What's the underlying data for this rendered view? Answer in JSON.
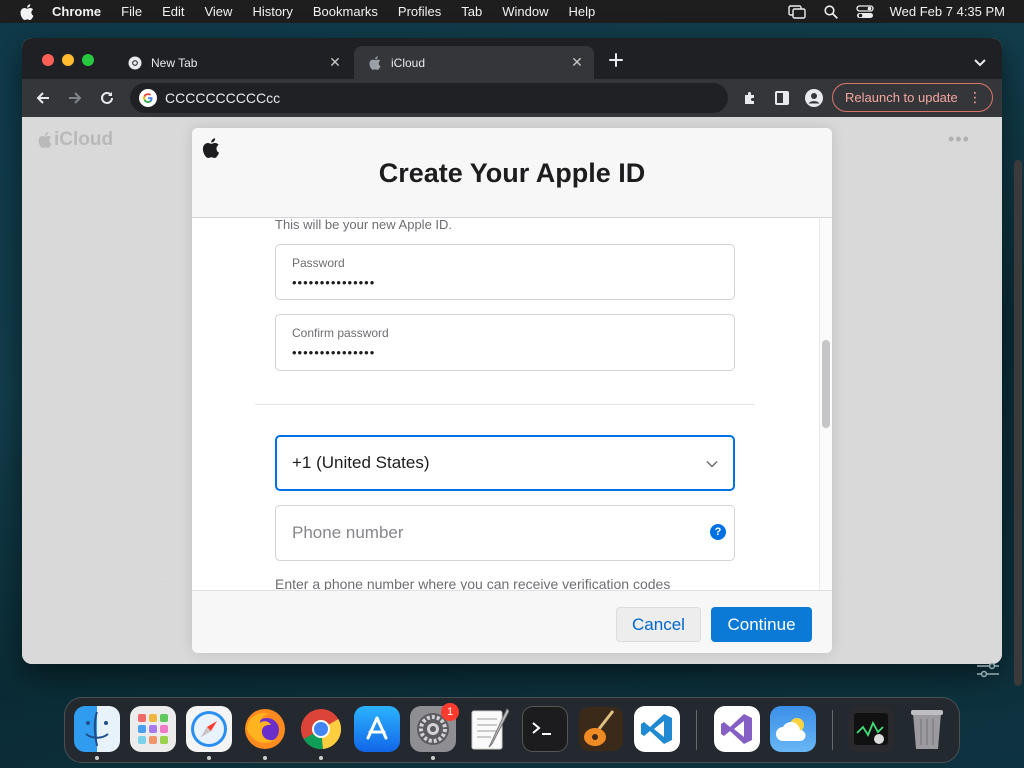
{
  "menubar": {
    "app_name": "Chrome",
    "items": [
      "File",
      "Edit",
      "View",
      "History",
      "Bookmarks",
      "Profiles",
      "Tab",
      "Window",
      "Help"
    ],
    "clock": "Wed Feb 7  4:35 PM"
  },
  "browser": {
    "tabs": [
      {
        "title": "New Tab",
        "icon": "chrome-icon",
        "active": false
      },
      {
        "title": "iCloud",
        "icon": "apple-icon",
        "active": true
      }
    ],
    "address": "CCCCCCCCCCcc",
    "relaunch_label": "Relaunch to update"
  },
  "page": {
    "logo_text": "iCloud",
    "dialog": {
      "title": "Create Your Apple ID",
      "new_id_hint": "This will be your new Apple ID.",
      "password": {
        "label": "Password",
        "value": "•••••••••••••••"
      },
      "confirm_password": {
        "label": "Confirm password",
        "value": "•••••••••••••••"
      },
      "country_code": "+1 (United States)",
      "phone_placeholder": "Phone number",
      "phone_help": "?",
      "phone_hint": "Enter a phone number where you can receive verification codes",
      "cancel_label": "Cancel",
      "continue_label": "Continue"
    }
  },
  "dock": {
    "apps": [
      "finder",
      "launchpad",
      "safari",
      "firefox",
      "chrome",
      "app-store",
      "system-settings",
      "textedit",
      "terminal",
      "garageband",
      "vscode",
      "visual-studio",
      "weather",
      "activity-monitor",
      "trash"
    ],
    "system_settings_badge": "1"
  },
  "colors": {
    "accent": "#0071e3",
    "continue_button": "#0a7ad6",
    "relaunch": "#f4a79d"
  }
}
